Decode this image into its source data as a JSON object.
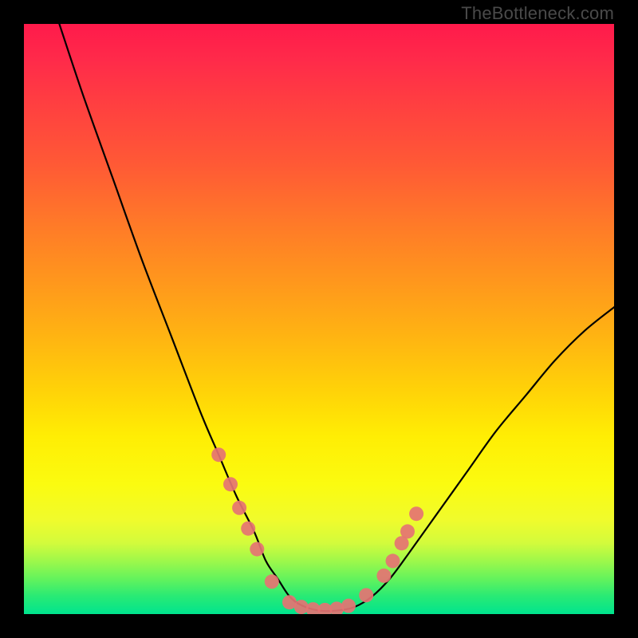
{
  "watermark": "TheBottleneck.com",
  "chart_data": {
    "type": "line",
    "title": "",
    "xlabel": "",
    "ylabel": "",
    "xlim": [
      0,
      100
    ],
    "ylim": [
      0,
      100
    ],
    "series": [
      {
        "name": "curve",
        "x": [
          6,
          10,
          15,
          20,
          25,
          30,
          33,
          36,
          39,
          41,
          43,
          45,
          47,
          50,
          53,
          56,
          59,
          62,
          65,
          70,
          75,
          80,
          85,
          90,
          95,
          100
        ],
        "y": [
          100,
          88,
          74,
          60,
          47,
          34,
          27,
          20,
          14,
          9,
          6,
          3,
          1.5,
          0.6,
          0.6,
          1.2,
          3,
          6,
          10,
          17,
          24,
          31,
          37,
          43,
          48,
          52
        ]
      }
    ],
    "markers": {
      "name": "highlighted-points",
      "color": "#e57373",
      "points": [
        {
          "x": 33.0,
          "y": 27.0
        },
        {
          "x": 35.0,
          "y": 22.0
        },
        {
          "x": 36.5,
          "y": 18.0
        },
        {
          "x": 38.0,
          "y": 14.5
        },
        {
          "x": 39.5,
          "y": 11.0
        },
        {
          "x": 42.0,
          "y": 5.5
        },
        {
          "x": 45.0,
          "y": 2.0
        },
        {
          "x": 47.0,
          "y": 1.2
        },
        {
          "x": 49.0,
          "y": 0.8
        },
        {
          "x": 51.0,
          "y": 0.7
        },
        {
          "x": 53.0,
          "y": 0.9
        },
        {
          "x": 55.0,
          "y": 1.4
        },
        {
          "x": 58.0,
          "y": 3.2
        },
        {
          "x": 61.0,
          "y": 6.5
        },
        {
          "x": 62.5,
          "y": 9.0
        },
        {
          "x": 64.0,
          "y": 12.0
        },
        {
          "x": 65.0,
          "y": 14.0
        },
        {
          "x": 66.5,
          "y": 17.0
        }
      ]
    },
    "gradient_stops": [
      {
        "pos": 0,
        "color": "#ff1a4b"
      },
      {
        "pos": 50,
        "color": "#ffb412"
      },
      {
        "pos": 78,
        "color": "#fbfb10"
      },
      {
        "pos": 100,
        "color": "#00e48e"
      }
    ]
  }
}
